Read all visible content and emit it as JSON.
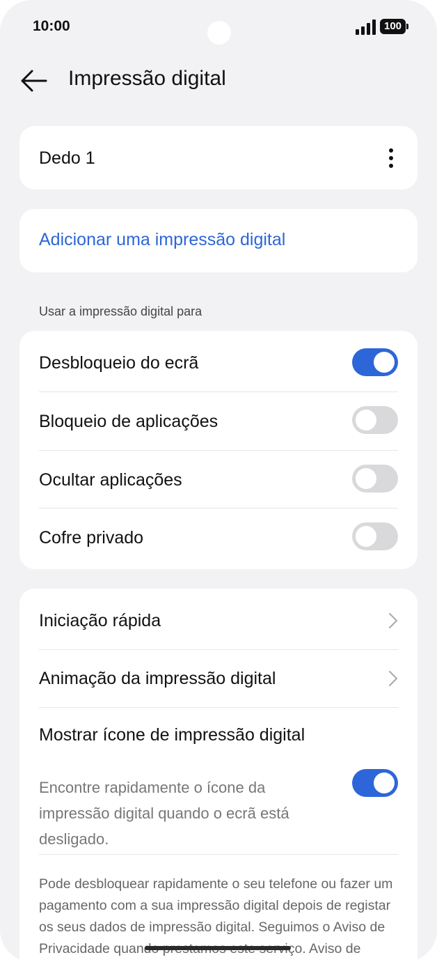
{
  "status_bar": {
    "time": "10:00",
    "battery": "100"
  },
  "header": {
    "title": "Impressão digital"
  },
  "finger_card": {
    "label": "Dedo 1"
  },
  "add_card": {
    "label": "Adicionar uma impressão digital"
  },
  "section": {
    "label": "Usar a impressão digital para"
  },
  "uses": [
    {
      "label": "Desbloqueio do ecrã",
      "on": true
    },
    {
      "label": "Bloqueio de aplicações",
      "on": false
    },
    {
      "label": "Ocultar aplicações",
      "on": false
    },
    {
      "label": "Cofre privado",
      "on": false
    }
  ],
  "more_settings": {
    "quick_launch": "Iniciação rápida",
    "animation": "Animação da impressão digital",
    "show_icon_title": "Mostrar ícone de impressão digital",
    "show_icon_desc": "Encontre rapidamente o ícone da impressão digital quando o ecrã está desligado.",
    "show_icon_on": true,
    "footer": "Pode desbloquear rapidamente o seu telefone ou fazer um pagamento com a sua impressão digital depois de registar os seus dados de impressão digital. Seguimos o Aviso de Privacidade quando prestamos este serviço. Aviso de Privacidade"
  },
  "colors": {
    "accent": "#2d66d8",
    "toggle_off": "#d9d9dc",
    "background": "#f2f2f5"
  }
}
